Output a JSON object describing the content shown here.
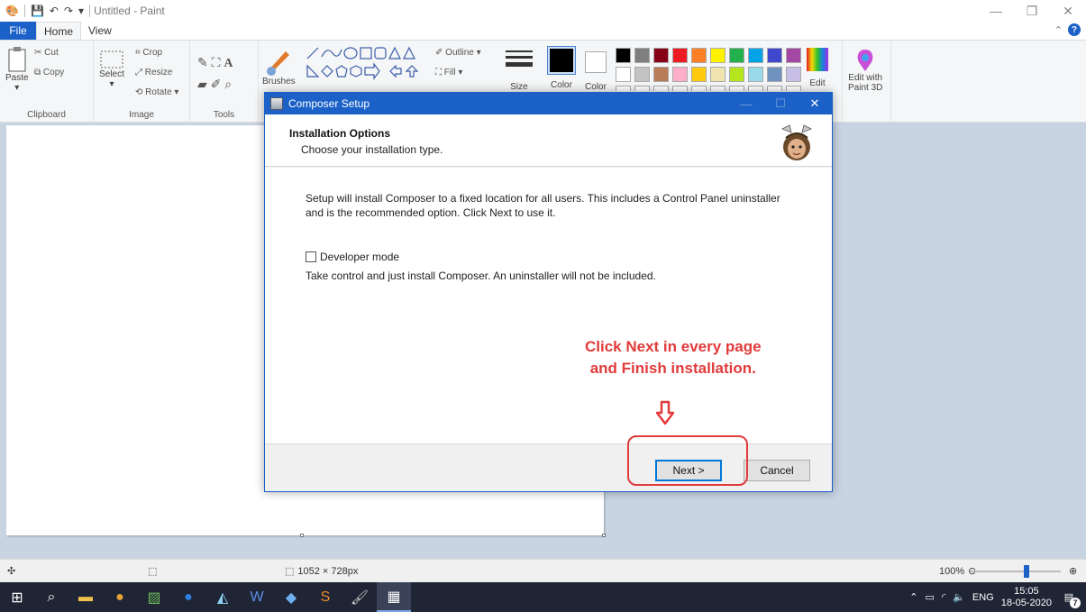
{
  "paint": {
    "title": "Untitled - Paint",
    "tabs": {
      "file": "File",
      "home": "Home",
      "view": "View"
    },
    "clipboard": {
      "paste": "Paste",
      "cut": "Cut",
      "copy": "Copy",
      "group": "Clipboard"
    },
    "image": {
      "select": "Select",
      "crop": "Crop",
      "resize": "Resize",
      "rotate": "Rotate",
      "group": "Image"
    },
    "tools": {
      "group": "Tools"
    },
    "brushes": "Brushes",
    "shapes": {
      "outline": "Outline",
      "fill": "Fill"
    },
    "size": "Size",
    "color1": "Color",
    "color2": "Color",
    "edit_colors": "Edit",
    "edit_with_3d": "Edit with",
    "edit_with_3d_2": "Paint 3D",
    "palette_row1": [
      "#000000",
      "#7f7f7f",
      "#880015",
      "#ed1c24",
      "#ff7f27",
      "#fff200",
      "#22b14c",
      "#00a2e8",
      "#3f48cc",
      "#a349a4"
    ],
    "palette_row2": [
      "#ffffff",
      "#c3c3c3",
      "#b97a57",
      "#ffaec9",
      "#ffc90e",
      "#efe4b0",
      "#b5e61d",
      "#99d9ea",
      "#7092be",
      "#c8bfe7"
    ]
  },
  "status": {
    "dimensions": "1052 × 728px",
    "zoom": "100%"
  },
  "taskbar": {
    "language": "ENG",
    "time": "15:05",
    "date": "18-05-2020",
    "notifications": "7"
  },
  "dialog": {
    "title": "Composer Setup",
    "heading": "Installation Options",
    "subheading": "Choose your installation type.",
    "description": "Setup will install Composer to a fixed location for all users. This includes a Control Panel uninstaller and is the recommended option. Click Next to use it.",
    "checkbox_label": "Developer mode",
    "checkbox_checked": false,
    "checkbox_description": "Take control and just install Composer. An uninstaller will not be included.",
    "annotation_line1": "Click Next in every page",
    "annotation_line2": "and Finish installation.",
    "next": "Next >",
    "cancel": "Cancel"
  }
}
